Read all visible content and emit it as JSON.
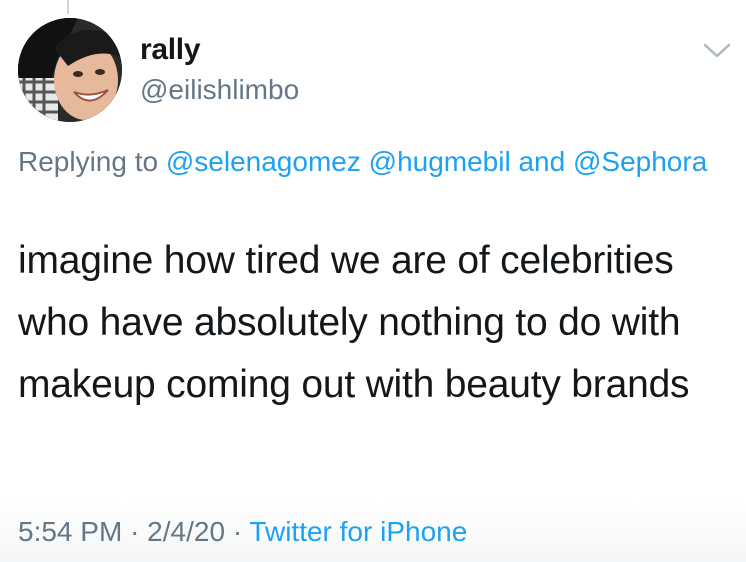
{
  "user": {
    "display_name": "rally",
    "handle": "@eilishlimbo"
  },
  "reply": {
    "prefix": "Replying to",
    "mentions": [
      "@selenagomez",
      "@hugmebil",
      "@Sephora"
    ],
    "conjunction": "and"
  },
  "tweet": {
    "text": "imagine how tired we are of celebrities who have absolutely nothing to do with makeup coming out with beauty brands"
  },
  "meta": {
    "time": "5:54 PM",
    "separator": "·",
    "date": "2/4/20",
    "source": "Twitter for iPhone"
  },
  "icons": {
    "menu": "chevron-down-icon"
  },
  "colors": {
    "link": "#1da1f2",
    "secondary_text": "#657786",
    "primary_text": "#14171a"
  }
}
